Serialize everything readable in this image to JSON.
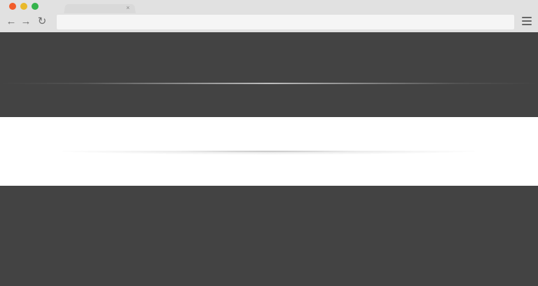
{
  "window": {
    "traffic_lights": {
      "close_color": "#f25c2a",
      "minimize_color": "#e9b92a",
      "maximize_color": "#34b34b"
    },
    "tab": {
      "close_glyph": "×"
    }
  },
  "toolbar": {
    "back_icon": "←",
    "forward_icon": "→",
    "reload_icon": "↻",
    "address_value": "",
    "menu_icon": "hamburger-menu-icon"
  },
  "page": {
    "sections": [
      {
        "name": "dark-top",
        "color": "#434343"
      },
      {
        "name": "light-middle",
        "color": "#ffffff"
      },
      {
        "name": "dark-bottom",
        "color": "#434343"
      }
    ]
  }
}
